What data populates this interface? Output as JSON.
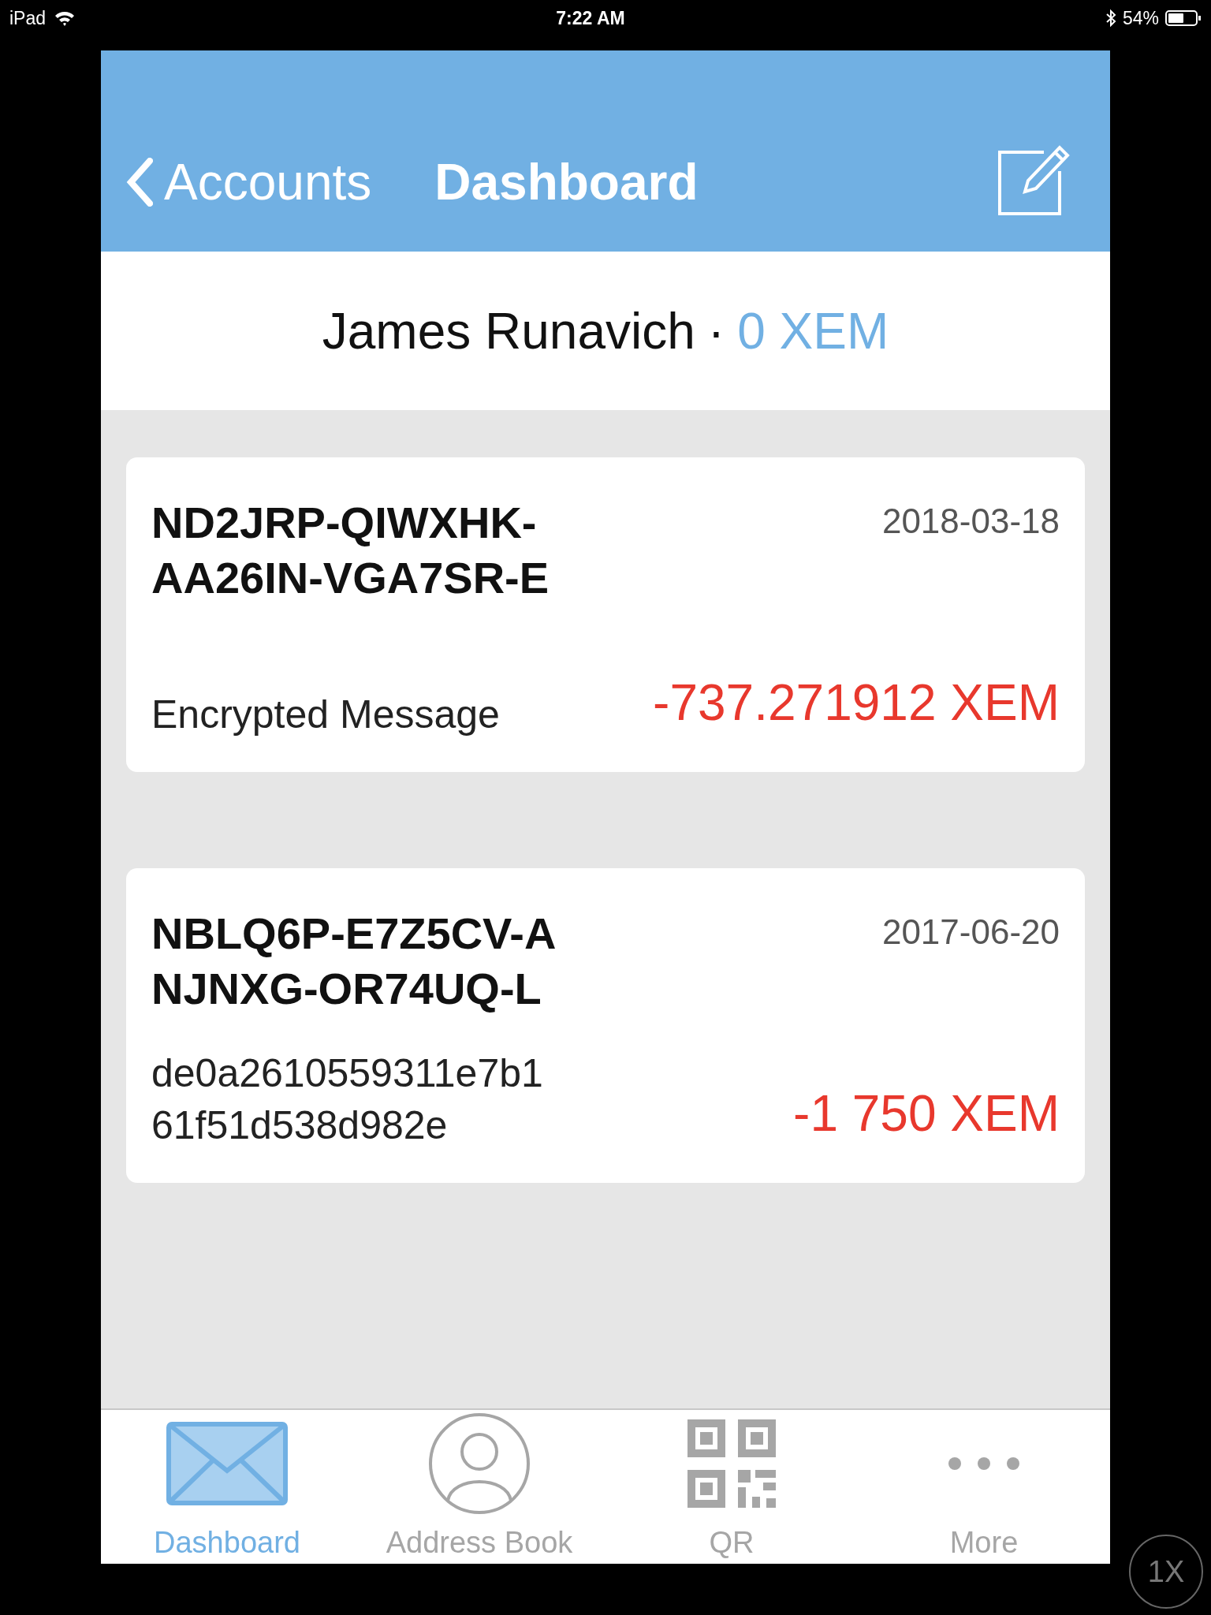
{
  "status_bar": {
    "device": "iPad",
    "time": "7:22 AM",
    "battery_percent": "54%"
  },
  "nav_bar": {
    "back_label": "Accounts",
    "title": "Dashboard"
  },
  "account": {
    "name": "James Runavich",
    "separator": "·",
    "balance": "0 XEM"
  },
  "transactions": [
    {
      "address_line_1": "ND2JRP-QIWXHK-",
      "address_line_2": "AA26IN-VGA7SR-E",
      "date": "2018-03-18",
      "message": "Encrypted Message",
      "amount": "-737.271912 XEM"
    },
    {
      "address_line_1": "NBLQ6P-E7Z5CV-A",
      "address_line_2": "NJNXG-OR74UQ-L",
      "date": "2017-06-20",
      "message": "de0a2610559311e7b1\n61f51d538d982e",
      "amount": "-1 750 XEM"
    }
  ],
  "tabs": [
    {
      "kind": "mail",
      "label": "Dashboard",
      "selected": true
    },
    {
      "kind": "person",
      "label": "Address Book",
      "selected": false
    },
    {
      "kind": "qr",
      "label": "QR",
      "selected": false
    },
    {
      "kind": "more",
      "label": "More",
      "selected": false
    }
  ],
  "zoom_button": "1X"
}
